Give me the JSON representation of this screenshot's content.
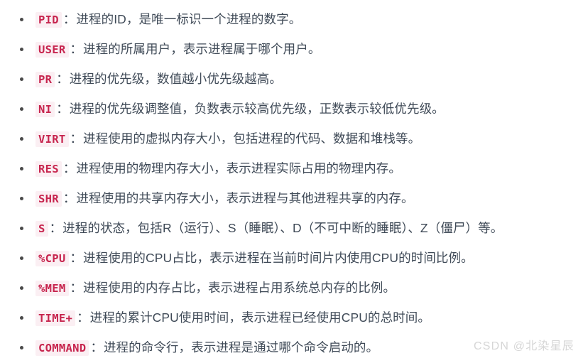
{
  "page": {
    "background_color": "#ffffff",
    "text_color": "#3f4a57",
    "code_text_color": "#c7254e",
    "code_background_color": "#fbeff3",
    "bullet_color": "#4a4a4a",
    "colon": "："
  },
  "list": {
    "items": [
      {
        "tag": "PID",
        "desc": "进程的ID，是唯一标识一个进程的数字。"
      },
      {
        "tag": "USER",
        "desc": "进程的所属用户，表示进程属于哪个用户。"
      },
      {
        "tag": "PR",
        "desc": "进程的优先级，数值越小优先级越高。"
      },
      {
        "tag": "NI",
        "desc": "进程的优先级调整值，负数表示较高优先级，正数表示较低优先级。"
      },
      {
        "tag": "VIRT",
        "desc": "进程使用的虚拟内存大小，包括进程的代码、数据和堆栈等。"
      },
      {
        "tag": "RES",
        "desc": "进程使用的物理内存大小，表示进程实际占用的物理内存。"
      },
      {
        "tag": "SHR",
        "desc": "进程使用的共享内存大小，表示进程与其他进程共享的内存。"
      },
      {
        "tag": "S",
        "desc": "进程的状态，包括R（运行）、S（睡眠）、D（不可中断的睡眠）、Z（僵尸）等。"
      },
      {
        "tag": "%CPU",
        "desc": "进程使用的CPU占比，表示进程在当前时间片内使用CPU的时间比例。"
      },
      {
        "tag": "%MEM",
        "desc": "进程使用的内存占比，表示进程占用系统总内存的比例。"
      },
      {
        "tag": "TIME+",
        "desc": "进程的累计CPU使用时间，表示进程已经使用CPU的总时间。"
      },
      {
        "tag": "COMMAND",
        "desc": "进程的命令行，表示进程是通过哪个命令启动的。"
      }
    ]
  },
  "watermark": {
    "text": "CSDN @北染星辰",
    "color": "#d6d6d6"
  }
}
